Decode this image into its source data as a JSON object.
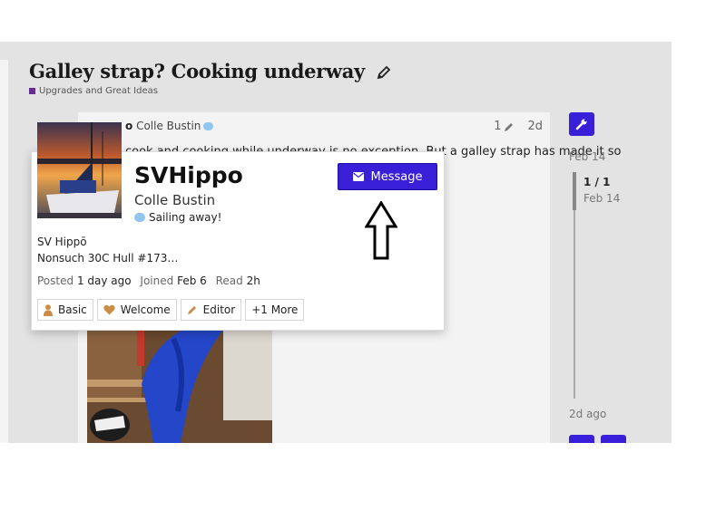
{
  "topic": {
    "title": "Galley strap? Cooking underway",
    "category": "Upgrades and Great Ideas",
    "category_color": "#652d90"
  },
  "post": {
    "username_partial": "o",
    "full_name": "Colle Bustin",
    "edit_count": "1",
    "age": "2d",
    "text_partial": "cook and cooking while underway is no exception. But a galley strap has made it so"
  },
  "timeline": {
    "start_date": "Feb 14",
    "position": "1 / 1",
    "position_date": "Feb 14",
    "end_label": "2d ago"
  },
  "user_card": {
    "username": "SVHippo",
    "full_name": "Colle Bustin",
    "status": "Sailing away!",
    "message_label": "Message",
    "bio_line1": "SV Hippō",
    "bio_line2": "Nonsuch 30C Hull #173…",
    "posted_label": "Posted",
    "posted_value": "1 day ago",
    "joined_label": "Joined",
    "joined_value": "Feb 6",
    "read_label": "Read",
    "read_value": "2h",
    "badges": [
      {
        "label": "Basic",
        "icon": "user-icon"
      },
      {
        "label": "Welcome",
        "icon": "heart-icon"
      },
      {
        "label": "Editor",
        "icon": "pencil-icon"
      },
      {
        "label": "+1 More",
        "icon": ""
      }
    ]
  },
  "colors": {
    "accent": "#3a1fd8",
    "badge_bronze": "#cd8c44",
    "background": "#e3e3e3"
  }
}
